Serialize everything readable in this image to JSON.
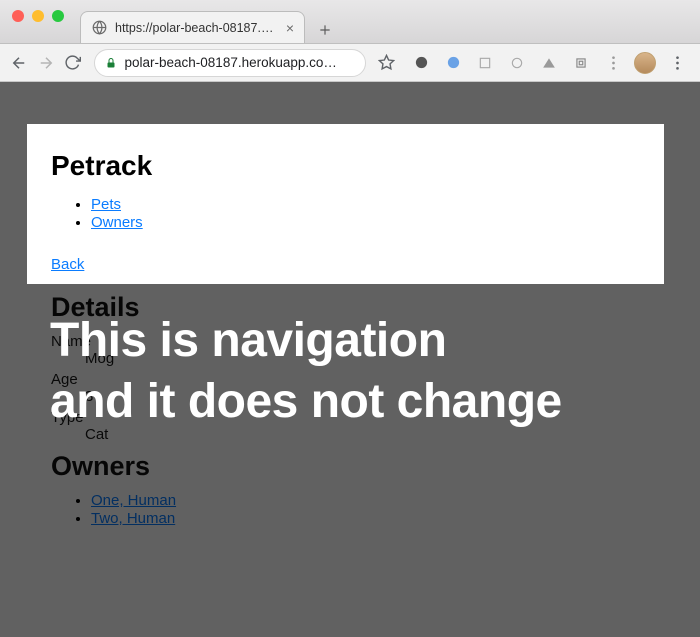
{
  "browser": {
    "tab_title": "https://polar-beach-08187.her",
    "url_display": "polar-beach-08187.herokuapp.co…"
  },
  "header": {
    "brand": "Petrack",
    "nav": [
      {
        "label": "Pets"
      },
      {
        "label": "Owners"
      }
    ],
    "back_label": "Back"
  },
  "details": {
    "heading": "Details",
    "fields": [
      {
        "term": "Name",
        "value": "Mog"
      },
      {
        "term": "Age",
        "value": "3"
      },
      {
        "term": "Type",
        "value": "Cat"
      }
    ]
  },
  "owners_section": {
    "heading": "Owners",
    "items": [
      {
        "label": "One, Human"
      },
      {
        "label": "Two, Human"
      }
    ]
  },
  "annotation": {
    "line1": "This is navigation",
    "line2": "and it does not change"
  }
}
